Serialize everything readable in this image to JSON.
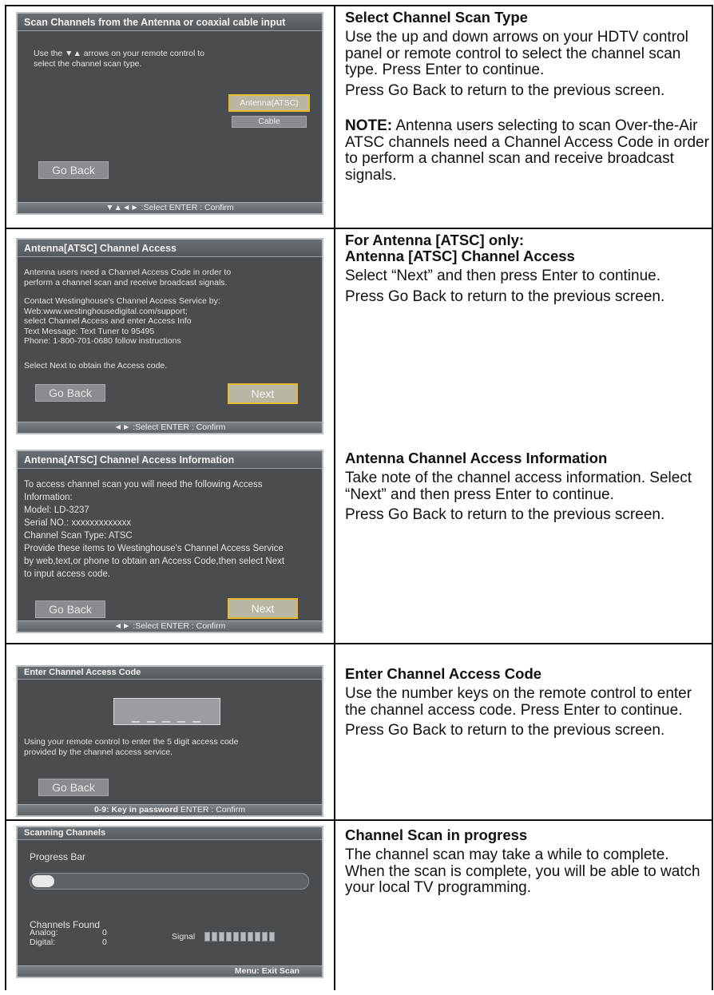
{
  "sections": [
    {
      "screen": {
        "title": "Scan Channels from the Antenna or coaxial cable input",
        "body": "Use the ▼▲ arrows on your remote control to\nselect the channel scan type.",
        "option_selected": "Antenna(ATSC)",
        "option_other": "Cable",
        "go_back": "Go Back",
        "footer": "▼▲◄► :Select    ENTER : Confirm"
      },
      "desc": {
        "heading": "Select Channel Scan Type",
        "p1": "Use the up and down arrows on your HDTV control panel or remote control to select the channel scan type. Press Enter to continue.",
        "p2": "Press Go Back to return to the previous screen.",
        "note_label": "NOTE:",
        "note_text": " Antenna users selecting to scan Over-the-Air ATSC channels need a Channel Access Code in order to perform a channel scan and receive broadcast signals."
      }
    },
    {
      "screen": {
        "title": "Antenna[ATSC] Channel Access",
        "body1": "Antenna users need a Channel Access Code in order to\nperform a channel scan and receive broadcast signals.",
        "body2": "Contact Westinghouse's Channel Access Service by:\n    Web:www.westinghousedigital.com/support;\n        select Channel Access and enter Access Info\n    Text Message: Text Tuner to 95495\n    Phone: 1-800-701-0680 follow instructions",
        "body3": "Select Next to obtain the Access code.",
        "go_back": "Go Back",
        "next": "Next",
        "footer": "◄► :Select    ENTER : Confirm"
      },
      "desc": {
        "heading1": "For Antenna [ATSC] only:",
        "heading2": "Antenna [ATSC] Channel Access",
        "p1": "Select “Next” and then press Enter to continue.",
        "p2": "Press Go Back to return to the previous screen."
      }
    },
    {
      "screen": {
        "title": "Antenna[ATSC] Channel Access Information",
        "body": "To access channel scan you will need the following Access\nInformation:\nModel:  LD-3237\nSerial NO.: xxxxxxxxxxxxx\nChannel Scan Type: ATSC\nProvide these items to Westinghouse's Channel Access Service\nby web,text,or phone to obtain an Access Code,then select Next\nto input access code.",
        "go_back": "Go Back",
        "next": "Next",
        "footer": "◄► :Select    ENTER : Confirm"
      },
      "desc": {
        "heading": "Antenna Channel Access Information",
        "p1": "Take note of the channel access information. Select “Next” and then press Enter to continue.",
        "p2": "Press Go Back to return to the previous screen."
      }
    },
    {
      "screen": {
        "title": "Enter Channel Access Code",
        "code_placeholder": "_ _ _ _ _",
        "body": "Using your remote control to enter the 5 digit access code\nprovided by the channel access service.",
        "go_back": "Go Back",
        "footer_bold": "0-9: Key in password",
        "footer_rest": "    ENTER : Confirm"
      },
      "desc": {
        "heading": "Enter Channel Access Code",
        "p1": "Use the number keys on the remote control to enter the channel access code. Press Enter to continue.",
        "p2": "Press Go Back to return to the previous screen."
      }
    },
    {
      "screen": {
        "title": "Scanning Channels",
        "progress_label": "Progress Bar",
        "progress_fraction": 0.08,
        "channels_found": "Channels Found",
        "analog_label": "Analog:",
        "analog_value": "0",
        "digital_label": "Digital:",
        "digital_value": "0",
        "signal_label": "Signal",
        "signal_bars": 10,
        "footer": "Menu: Exit Scan"
      },
      "desc": {
        "heading": "Channel Scan in progress",
        "p1": "The channel scan may take a while to complete. When the scan is complete, you will be able to watch your local TV programming."
      }
    }
  ],
  "colors": {
    "screen_bg": "#4a4d50",
    "highlight_border": "#e5b92a"
  }
}
